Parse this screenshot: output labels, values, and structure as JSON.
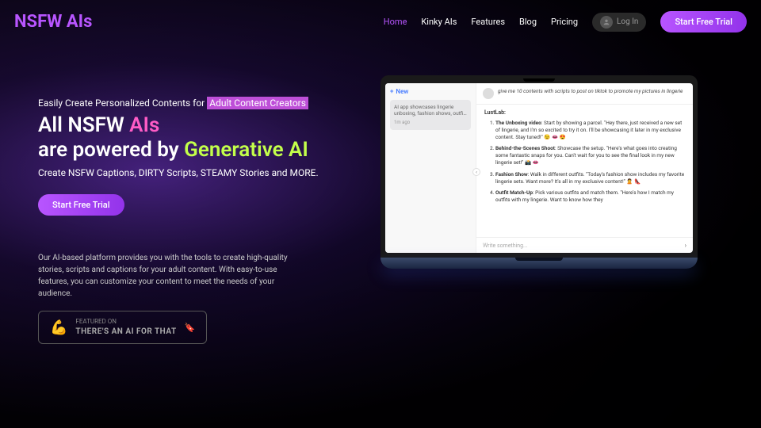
{
  "logo": {
    "text1": "NSFW ",
    "text2": "AIs"
  },
  "nav": {
    "home": "Home",
    "kinky": "Kinky AIs",
    "features": "Features",
    "blog": "Blog",
    "pricing": "Pricing",
    "login": "Log In",
    "cta": "Start Free Trial"
  },
  "hero": {
    "tagline_pre": "Easily Create Personalized Contents for ",
    "tagline_hl": "Adult Content Creators",
    "headline_p1": "All NSFW ",
    "headline_p2": "AIs",
    "headline_p3": "are powered by ",
    "headline_p4": "Generative AI",
    "subheadline": "Create NSFW Captions, DIRTY Scripts, STEAMY Stories and MORE.",
    "cta": "Start Free Trial",
    "description": "Our AI-based platform provides you with the tools to create high-quality stories, scripts and captions for your adult content. With easy-to-use features, you can customize your content to meet the needs of your audience.",
    "badge_top": "FEATURED ON",
    "badge_bottom": "THERE'S AN AI FOR THAT"
  },
  "app": {
    "new_label": "New",
    "sidebar_item_title": "AI app showcases lingerie unboxing, fashion shows, outfi…",
    "sidebar_item_time": "1m ago",
    "prompt": "give me 10 contents with scripts to post on tiktok to promote my pictures in lingerie",
    "response_label": "LustLab:",
    "items": [
      {
        "title": "The Unboxing video",
        "body": ": Start by showing a parcel. \"Hey there, just received a new set of lingerie, and I'm so excited to try it on. I'll be showcasing it later in my exclusive content. Stay tuned!\" 😉 👄 😍"
      },
      {
        "title": "Behind-the-Scenes Shoot",
        "body": ": Showcase the setup. \"Here's what goes into creating some fantastic snaps for you. Can't wait for you to see the final look in my new lingerie set!\" 📸 👄"
      },
      {
        "title": "Fashion Show",
        "body": ": Walk in different outfits. \"Today's fashion show includes my favorite lingerie sets. Want more? It's all in my exclusive content!\" 🙎 👠"
      },
      {
        "title": "Outfit Match-Up",
        "body": ": Pick various outfits and match them. \"Here's how I match my outfits with my lingerie. Want to know how they"
      }
    ],
    "input_placeholder": "Write something...",
    "arrow_back": "‹",
    "arrow_send": "›"
  }
}
